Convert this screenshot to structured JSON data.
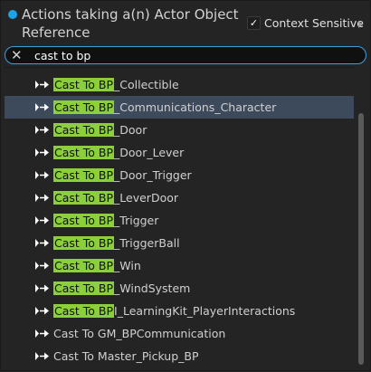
{
  "header": {
    "title": "Actions taking a(n) Actor Object Reference",
    "context_sensitive_label": "Context Sensitive",
    "context_sensitive_checked": true,
    "accent_color": "#1aa3e8"
  },
  "search": {
    "value": "cast to bp",
    "clear_icon": "close-icon"
  },
  "items": [
    {
      "highlight": "Cast To BP",
      "rest": "_Collectible",
      "selected": false
    },
    {
      "highlight": "Cast To BP",
      "rest": "_Communications_Character",
      "selected": true
    },
    {
      "highlight": "Cast To BP",
      "rest": "_Door",
      "selected": false
    },
    {
      "highlight": "Cast To BP",
      "rest": "_Door_Lever",
      "selected": false
    },
    {
      "highlight": "Cast To BP",
      "rest": "_Door_Trigger",
      "selected": false
    },
    {
      "highlight": "Cast To BP",
      "rest": "_LeverDoor",
      "selected": false
    },
    {
      "highlight": "Cast To BP",
      "rest": "_Trigger",
      "selected": false
    },
    {
      "highlight": "Cast To BP",
      "rest": "_TriggerBall",
      "selected": false
    },
    {
      "highlight": "Cast To BP",
      "rest": "_Win",
      "selected": false
    },
    {
      "highlight": "Cast To BP",
      "rest": "_WindSystem",
      "selected": false
    },
    {
      "highlight": "Cast To BP",
      "rest": "I_LearningKit_PlayerInteractions",
      "selected": false
    },
    {
      "highlight": "",
      "rest": "Cast To GM_BPCommunication",
      "selected": false
    },
    {
      "highlight": "",
      "rest": "Cast To Master_Pickup_BP",
      "selected": false
    }
  ],
  "highlight_color": "#8ccf3c",
  "selection_color": "#3d4a5c"
}
